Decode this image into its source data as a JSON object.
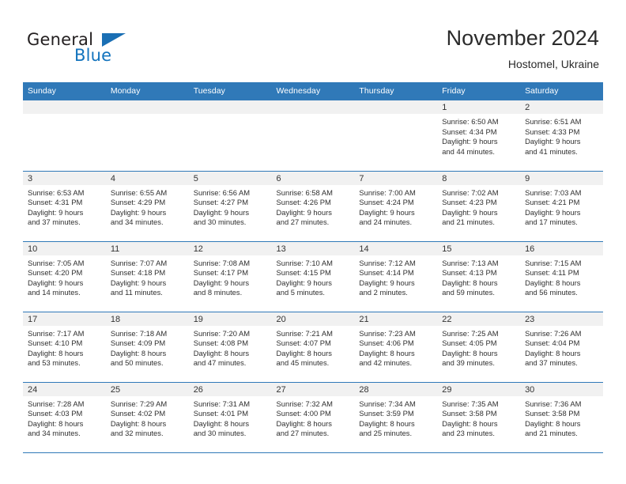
{
  "brand": {
    "name_part1": "General",
    "name_part2": "Blue",
    "flag_icon": "triangle-flag-icon"
  },
  "header": {
    "title": "November 2024",
    "subtitle": "Hostomel, Ukraine"
  },
  "colors": {
    "header_blue": "#3079b8",
    "brand_blue": "#1273bd",
    "daynum_band": "#f1f1f1",
    "text": "#2f2f2f"
  },
  "weekday_headers": [
    "Sunday",
    "Monday",
    "Tuesday",
    "Wednesday",
    "Thursday",
    "Friday",
    "Saturday"
  ],
  "weeks": [
    [
      {
        "day": "",
        "sunrise": "",
        "sunset": "",
        "daylight1": "",
        "daylight2": ""
      },
      {
        "day": "",
        "sunrise": "",
        "sunset": "",
        "daylight1": "",
        "daylight2": ""
      },
      {
        "day": "",
        "sunrise": "",
        "sunset": "",
        "daylight1": "",
        "daylight2": ""
      },
      {
        "day": "",
        "sunrise": "",
        "sunset": "",
        "daylight1": "",
        "daylight2": ""
      },
      {
        "day": "",
        "sunrise": "",
        "sunset": "",
        "daylight1": "",
        "daylight2": ""
      },
      {
        "day": "1",
        "sunrise": "Sunrise: 6:50 AM",
        "sunset": "Sunset: 4:34 PM",
        "daylight1": "Daylight: 9 hours",
        "daylight2": "and 44 minutes."
      },
      {
        "day": "2",
        "sunrise": "Sunrise: 6:51 AM",
        "sunset": "Sunset: 4:33 PM",
        "daylight1": "Daylight: 9 hours",
        "daylight2": "and 41 minutes."
      }
    ],
    [
      {
        "day": "3",
        "sunrise": "Sunrise: 6:53 AM",
        "sunset": "Sunset: 4:31 PM",
        "daylight1": "Daylight: 9 hours",
        "daylight2": "and 37 minutes."
      },
      {
        "day": "4",
        "sunrise": "Sunrise: 6:55 AM",
        "sunset": "Sunset: 4:29 PM",
        "daylight1": "Daylight: 9 hours",
        "daylight2": "and 34 minutes."
      },
      {
        "day": "5",
        "sunrise": "Sunrise: 6:56 AM",
        "sunset": "Sunset: 4:27 PM",
        "daylight1": "Daylight: 9 hours",
        "daylight2": "and 30 minutes."
      },
      {
        "day": "6",
        "sunrise": "Sunrise: 6:58 AM",
        "sunset": "Sunset: 4:26 PM",
        "daylight1": "Daylight: 9 hours",
        "daylight2": "and 27 minutes."
      },
      {
        "day": "7",
        "sunrise": "Sunrise: 7:00 AM",
        "sunset": "Sunset: 4:24 PM",
        "daylight1": "Daylight: 9 hours",
        "daylight2": "and 24 minutes."
      },
      {
        "day": "8",
        "sunrise": "Sunrise: 7:02 AM",
        "sunset": "Sunset: 4:23 PM",
        "daylight1": "Daylight: 9 hours",
        "daylight2": "and 21 minutes."
      },
      {
        "day": "9",
        "sunrise": "Sunrise: 7:03 AM",
        "sunset": "Sunset: 4:21 PM",
        "daylight1": "Daylight: 9 hours",
        "daylight2": "and 17 minutes."
      }
    ],
    [
      {
        "day": "10",
        "sunrise": "Sunrise: 7:05 AM",
        "sunset": "Sunset: 4:20 PM",
        "daylight1": "Daylight: 9 hours",
        "daylight2": "and 14 minutes."
      },
      {
        "day": "11",
        "sunrise": "Sunrise: 7:07 AM",
        "sunset": "Sunset: 4:18 PM",
        "daylight1": "Daylight: 9 hours",
        "daylight2": "and 11 minutes."
      },
      {
        "day": "12",
        "sunrise": "Sunrise: 7:08 AM",
        "sunset": "Sunset: 4:17 PM",
        "daylight1": "Daylight: 9 hours",
        "daylight2": "and 8 minutes."
      },
      {
        "day": "13",
        "sunrise": "Sunrise: 7:10 AM",
        "sunset": "Sunset: 4:15 PM",
        "daylight1": "Daylight: 9 hours",
        "daylight2": "and 5 minutes."
      },
      {
        "day": "14",
        "sunrise": "Sunrise: 7:12 AM",
        "sunset": "Sunset: 4:14 PM",
        "daylight1": "Daylight: 9 hours",
        "daylight2": "and 2 minutes."
      },
      {
        "day": "15",
        "sunrise": "Sunrise: 7:13 AM",
        "sunset": "Sunset: 4:13 PM",
        "daylight1": "Daylight: 8 hours",
        "daylight2": "and 59 minutes."
      },
      {
        "day": "16",
        "sunrise": "Sunrise: 7:15 AM",
        "sunset": "Sunset: 4:11 PM",
        "daylight1": "Daylight: 8 hours",
        "daylight2": "and 56 minutes."
      }
    ],
    [
      {
        "day": "17",
        "sunrise": "Sunrise: 7:17 AM",
        "sunset": "Sunset: 4:10 PM",
        "daylight1": "Daylight: 8 hours",
        "daylight2": "and 53 minutes."
      },
      {
        "day": "18",
        "sunrise": "Sunrise: 7:18 AM",
        "sunset": "Sunset: 4:09 PM",
        "daylight1": "Daylight: 8 hours",
        "daylight2": "and 50 minutes."
      },
      {
        "day": "19",
        "sunrise": "Sunrise: 7:20 AM",
        "sunset": "Sunset: 4:08 PM",
        "daylight1": "Daylight: 8 hours",
        "daylight2": "and 47 minutes."
      },
      {
        "day": "20",
        "sunrise": "Sunrise: 7:21 AM",
        "sunset": "Sunset: 4:07 PM",
        "daylight1": "Daylight: 8 hours",
        "daylight2": "and 45 minutes."
      },
      {
        "day": "21",
        "sunrise": "Sunrise: 7:23 AM",
        "sunset": "Sunset: 4:06 PM",
        "daylight1": "Daylight: 8 hours",
        "daylight2": "and 42 minutes."
      },
      {
        "day": "22",
        "sunrise": "Sunrise: 7:25 AM",
        "sunset": "Sunset: 4:05 PM",
        "daylight1": "Daylight: 8 hours",
        "daylight2": "and 39 minutes."
      },
      {
        "day": "23",
        "sunrise": "Sunrise: 7:26 AM",
        "sunset": "Sunset: 4:04 PM",
        "daylight1": "Daylight: 8 hours",
        "daylight2": "and 37 minutes."
      }
    ],
    [
      {
        "day": "24",
        "sunrise": "Sunrise: 7:28 AM",
        "sunset": "Sunset: 4:03 PM",
        "daylight1": "Daylight: 8 hours",
        "daylight2": "and 34 minutes."
      },
      {
        "day": "25",
        "sunrise": "Sunrise: 7:29 AM",
        "sunset": "Sunset: 4:02 PM",
        "daylight1": "Daylight: 8 hours",
        "daylight2": "and 32 minutes."
      },
      {
        "day": "26",
        "sunrise": "Sunrise: 7:31 AM",
        "sunset": "Sunset: 4:01 PM",
        "daylight1": "Daylight: 8 hours",
        "daylight2": "and 30 minutes."
      },
      {
        "day": "27",
        "sunrise": "Sunrise: 7:32 AM",
        "sunset": "Sunset: 4:00 PM",
        "daylight1": "Daylight: 8 hours",
        "daylight2": "and 27 minutes."
      },
      {
        "day": "28",
        "sunrise": "Sunrise: 7:34 AM",
        "sunset": "Sunset: 3:59 PM",
        "daylight1": "Daylight: 8 hours",
        "daylight2": "and 25 minutes."
      },
      {
        "day": "29",
        "sunrise": "Sunrise: 7:35 AM",
        "sunset": "Sunset: 3:58 PM",
        "daylight1": "Daylight: 8 hours",
        "daylight2": "and 23 minutes."
      },
      {
        "day": "30",
        "sunrise": "Sunrise: 7:36 AM",
        "sunset": "Sunset: 3:58 PM",
        "daylight1": "Daylight: 8 hours",
        "daylight2": "and 21 minutes."
      }
    ]
  ]
}
